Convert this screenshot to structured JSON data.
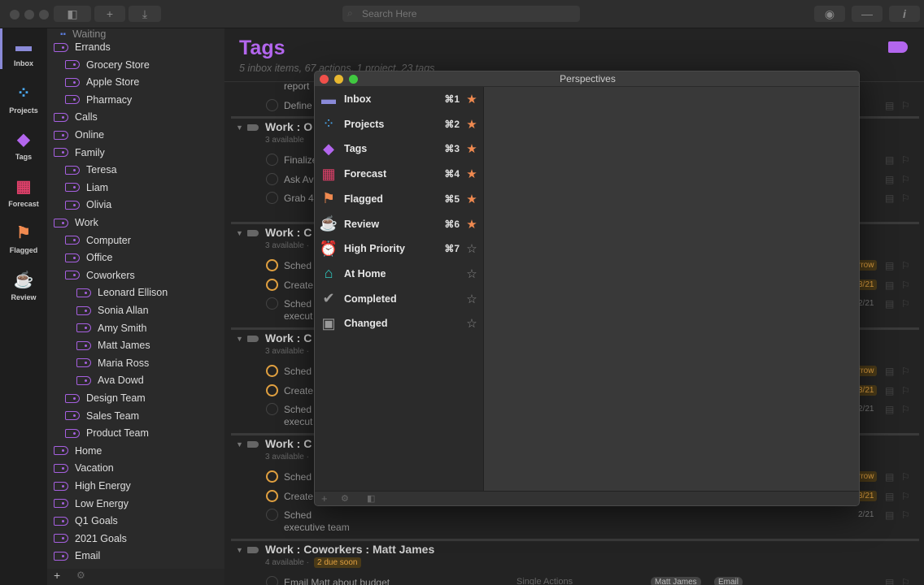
{
  "toolbar": {
    "search_placeholder": "Search Here",
    "icons": [
      "sidebar-toggle-icon",
      "plus-icon",
      "download-icon",
      "eye-icon",
      "minus-icon",
      "info-icon"
    ]
  },
  "rail": [
    {
      "label": "Inbox",
      "icon": "inbox-icon",
      "color": "#8a8ad8"
    },
    {
      "label": "Projects",
      "icon": "projects-icon",
      "color": "#4aa8f0"
    },
    {
      "label": "Tags",
      "icon": "tag-icon",
      "color": "#b366ee"
    },
    {
      "label": "Forecast",
      "icon": "forecast-icon",
      "color": "#e0406a"
    },
    {
      "label": "Flagged",
      "icon": "flag-icon",
      "color": "#f08a50"
    },
    {
      "label": "Review",
      "icon": "review-icon",
      "color": "#8a7ae8"
    }
  ],
  "taglist": {
    "partial_top": "Waiting",
    "items": [
      {
        "label": "Errands",
        "level": 0
      },
      {
        "label": "Grocery Store",
        "level": 1
      },
      {
        "label": "Apple Store",
        "level": 1
      },
      {
        "label": "Pharmacy",
        "level": 1
      },
      {
        "label": "Calls",
        "level": 0
      },
      {
        "label": "Online",
        "level": 0
      },
      {
        "label": "Family",
        "level": 0
      },
      {
        "label": "Teresa",
        "level": 1
      },
      {
        "label": "Liam",
        "level": 1
      },
      {
        "label": "Olivia",
        "level": 1
      },
      {
        "label": "Work",
        "level": 0
      },
      {
        "label": "Computer",
        "level": 1
      },
      {
        "label": "Office",
        "level": 1
      },
      {
        "label": "Coworkers",
        "level": 1
      },
      {
        "label": "Leonard Ellison",
        "level": 2
      },
      {
        "label": "Sonia Allan",
        "level": 2
      },
      {
        "label": "Amy Smith",
        "level": 2
      },
      {
        "label": "Matt James",
        "level": 2
      },
      {
        "label": "Maria Ross",
        "level": 2
      },
      {
        "label": "Ava Dowd",
        "level": 2
      },
      {
        "label": "Design Team",
        "level": 1
      },
      {
        "label": "Sales Team",
        "level": 1
      },
      {
        "label": "Product Team",
        "level": 1
      },
      {
        "label": "Home",
        "level": 0
      },
      {
        "label": "Vacation",
        "level": 0
      },
      {
        "label": "High Energy",
        "level": 0
      },
      {
        "label": "Low Energy",
        "level": 0
      },
      {
        "label": "Q1 Goals",
        "level": 0
      },
      {
        "label": "2021 Goals",
        "level": 0
      },
      {
        "label": "Email",
        "level": 0
      }
    ],
    "footer_add": "+",
    "footer_gear": "⚙"
  },
  "main": {
    "title": "Tags",
    "subtitle": "5 inbox items, 67 actions, 1 project, 23 tags",
    "rows_top": [
      {
        "text": "report"
      },
      {
        "text": "Define",
        "circle": "normal"
      }
    ],
    "groups": [
      {
        "title": "Work : O",
        "sub": "3 available",
        "rows": [
          {
            "text": "Finalize",
            "circle": "normal"
          },
          {
            "text": "Ask Av",
            "circle": "normal"
          },
          {
            "text": "Grab 4",
            "circle": "normal"
          }
        ]
      },
      {
        "title": "Work : C",
        "sub": "3 available ·",
        "rows": [
          {
            "text": "Sched",
            "circle": "due",
            "date": "rrow"
          },
          {
            "text": "Create",
            "circle": "due",
            "date": "3/21"
          },
          {
            "text": "Sched",
            "text2": "execut",
            "circle": "normal",
            "date": "2/21"
          }
        ]
      },
      {
        "title": "Work : C",
        "sub": "3 available ·",
        "rows": [
          {
            "text": "Sched",
            "circle": "due",
            "date": "rrow"
          },
          {
            "text": "Create",
            "circle": "due",
            "date": "3/21"
          },
          {
            "text": "Sched",
            "text2": "execut",
            "circle": "normal",
            "date": "2/21"
          }
        ]
      },
      {
        "title": "Work : C",
        "sub": "3 available ·",
        "rows": [
          {
            "text": "Sched",
            "circle": "due",
            "date": "rrow"
          },
          {
            "text": "Create",
            "circle": "due",
            "date": "3/21"
          },
          {
            "text": "Sched",
            "text2": "executive team",
            "circle": "normal",
            "date": "2/21"
          }
        ]
      },
      {
        "title": "Work : Coworkers : Matt James",
        "sub": "4 available ·",
        "badge": "2 due soon",
        "rows": [
          {
            "text": "Email Matt about budget",
            "circle": "normal",
            "project": "Single Actions",
            "tags": [
              "Matt James",
              "Email"
            ]
          }
        ]
      }
    ]
  },
  "perspectives": {
    "title": "Perspectives",
    "items": [
      {
        "label": "Inbox",
        "key": "⌘1",
        "starred": true,
        "icon": "inbox-icon",
        "color": "#8a8ad8"
      },
      {
        "label": "Projects",
        "key": "⌘2",
        "starred": true,
        "icon": "projects-icon",
        "color": "#4aa8f0"
      },
      {
        "label": "Tags",
        "key": "⌘3",
        "starred": true,
        "icon": "tag-icon",
        "color": "#b366ee"
      },
      {
        "label": "Forecast",
        "key": "⌘4",
        "starred": true,
        "icon": "forecast-icon",
        "color": "#e0406a"
      },
      {
        "label": "Flagged",
        "key": "⌘5",
        "starred": true,
        "icon": "flag-icon",
        "color": "#f08a50"
      },
      {
        "label": "Review",
        "key": "⌘6",
        "starred": true,
        "icon": "review-icon",
        "color": "#8a7ae8"
      },
      {
        "label": "High Priority",
        "key": "⌘7",
        "starred": false,
        "icon": "alarm-clock-icon",
        "color": "#30d080"
      },
      {
        "label": "At Home",
        "key": "",
        "starred": false,
        "icon": "house-icon",
        "color": "#30c8c0"
      },
      {
        "label": "Completed",
        "key": "",
        "starred": false,
        "icon": "checkmark-icon",
        "color": "#999999"
      },
      {
        "label": "Changed",
        "key": "",
        "starred": false,
        "icon": "calendar-icon",
        "color": "#999999"
      }
    ],
    "footer": {
      "add": "+",
      "gear": "⚙",
      "sidebar": "◧"
    }
  },
  "colors": {
    "accent": "#b366ee",
    "star": "#f08a50",
    "due": "#e0a040"
  }
}
